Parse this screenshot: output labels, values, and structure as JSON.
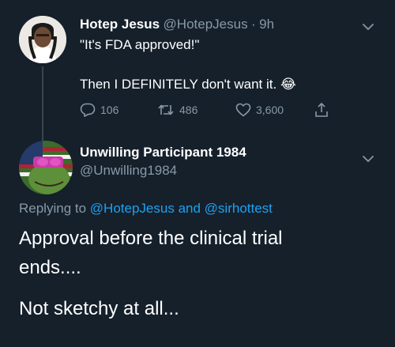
{
  "tweet1": {
    "name": "Hotep Jesus",
    "handle": "@HotepJesus",
    "separator": "·",
    "time": "9h",
    "line1": "\"It's FDA approved!\"",
    "line2": "Then I DEFINITELY don't want it.",
    "emoji": "😂",
    "replies": "106",
    "retweets": "486",
    "likes": "3,600"
  },
  "tweet2": {
    "name": "Unwilling Participant 1984",
    "handle": "@Unwilling1984",
    "replying_prefix": "Replying to",
    "reply_user1": "@HotepJesus",
    "reply_and": "and",
    "reply_user2": "@sirhottest",
    "text_line1": "Approval before the clinical trial",
    "text_line2": "ends....",
    "text_line3": "Not sketchy at all..."
  },
  "colors": {
    "background": "#15202b",
    "secondary_text": "#8899a6",
    "link": "#1da1f2"
  },
  "icons": [
    "chevron-down-icon",
    "reply-icon",
    "retweet-icon",
    "like-icon",
    "share-icon"
  ]
}
